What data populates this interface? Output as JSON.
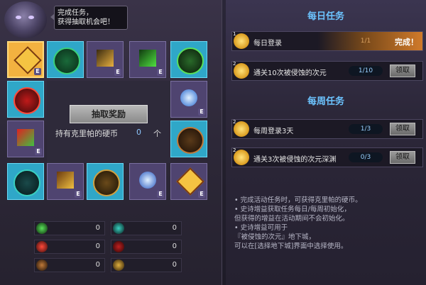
{
  "speech_bubble": "完成任务，\n获得抽取机会吧！",
  "draw_button": "抽取奖励",
  "coins": {
    "label": "持有克里帕的硬币",
    "count": "0",
    "unit": "个"
  },
  "tile_badge": "E",
  "counters": [
    {
      "icon": "green-rune-icon",
      "value": "0"
    },
    {
      "icon": "teal-rune-icon",
      "value": "0"
    },
    {
      "icon": "red-rune-icon",
      "value": "0"
    },
    {
      "icon": "crimson-rune-icon",
      "value": "0"
    },
    {
      "icon": "bronze-rune-icon",
      "value": "0"
    },
    {
      "icon": "gold-rune-icon",
      "value": "0"
    }
  ],
  "daily": {
    "title": "每日任务",
    "tasks": [
      {
        "coin_num": "1",
        "label": "每日登录",
        "progress": "1/1",
        "action": "完成！",
        "done": true
      },
      {
        "coin_num": "2",
        "label": "通关10次被侵蚀的次元",
        "progress": "1/10",
        "action": "领取",
        "done": false
      }
    ]
  },
  "weekly": {
    "title": "每周任务",
    "tasks": [
      {
        "coin_num": "2",
        "label": "每周登录3天",
        "progress": "1/3",
        "action": "领取"
      },
      {
        "coin_num": "2",
        "label": "通关3次被侵蚀的次元深渊",
        "progress": "0/3",
        "action": "领取"
      }
    ]
  },
  "notes": [
    "• 完成活动任务时，可获得克里帕的硬币。",
    "• 史诗增益获取任务每日/每周初始化，",
    "  但获得的增益在活动期间不会初始化。",
    "• 史诗增益可用于",
    "  『被侵蚀的次元』地下城，",
    "  可以在[选择地下城]界面中选择使用。"
  ],
  "colors": {
    "accent_blue": "#6cc4ff",
    "tile_cyan": "#2fa7c8",
    "tile_violet": "#4f4470",
    "selected_gold": "#f3b240"
  }
}
